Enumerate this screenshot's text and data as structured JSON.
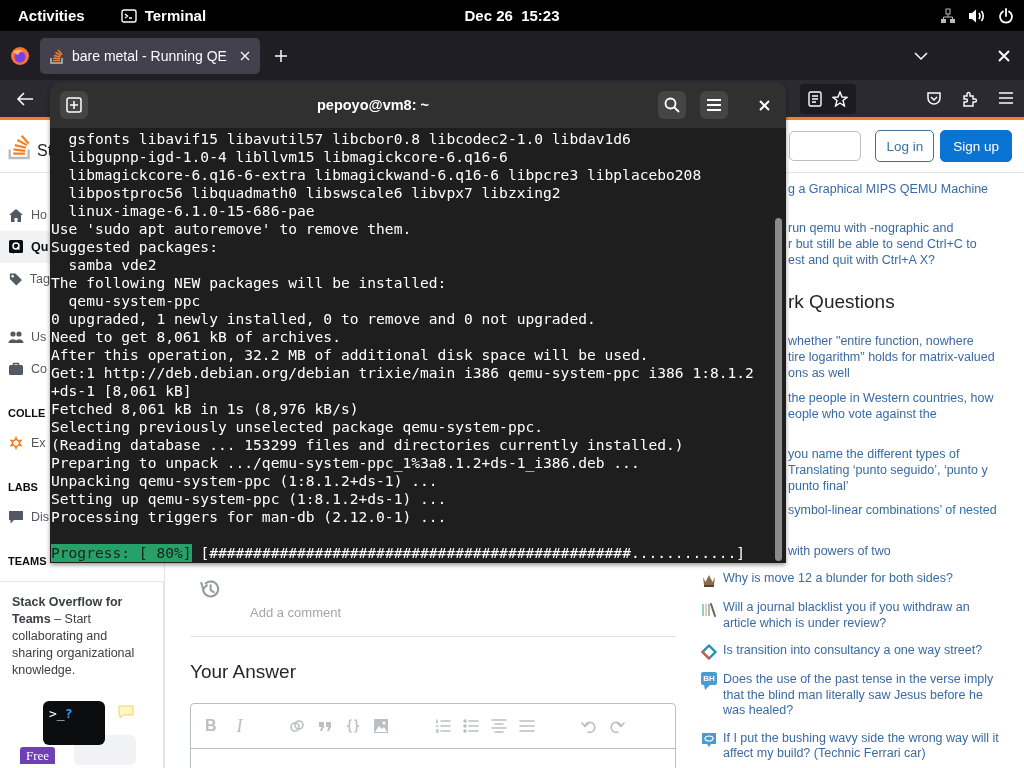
{
  "top_bar": {
    "activities": "Activities",
    "app": "Terminal",
    "clock": "Dec 26  15:23"
  },
  "browser": {
    "tabs": [
      {
        "title": "bare metal - Running QE",
        "selected": true
      }
    ]
  },
  "page": {
    "header": {
      "logo_text": "St",
      "login": "Log in",
      "signup": "Sign up"
    },
    "nav": [
      {
        "kind": "item",
        "label": "Ho",
        "selected": false
      },
      {
        "kind": "item",
        "label": "Qu",
        "selected": true
      },
      {
        "kind": "item",
        "label": "Tag",
        "selected": false
      },
      {
        "kind": "gap"
      },
      {
        "kind": "item",
        "label": "Us",
        "selected": false
      },
      {
        "kind": "item",
        "label": "Co",
        "selected": false
      },
      {
        "kind": "heading",
        "label": "COLLE"
      },
      {
        "kind": "item",
        "label": "Ex",
        "selected": false
      },
      {
        "kind": "heading",
        "label": "LABS"
      },
      {
        "kind": "item",
        "label": "Dis",
        "selected": false
      },
      {
        "kind": "heading",
        "label": "TEAMS"
      }
    ],
    "teams_card": {
      "text": "**Stack Overflow for Teams** – Start collaborating and sharing organizational knowledge.",
      "prompt": ">_",
      "prompt_mark": "?",
      "badge": "Free"
    },
    "main": {
      "add_comment": "Add a comment",
      "answer_heading": "Your Answer",
      "toolbar": [
        {
          "kind": "bold",
          "label": "B"
        },
        {
          "kind": "italic",
          "label": "I"
        },
        {
          "kind": "sep"
        },
        {
          "kind": "link"
        },
        {
          "kind": "quote"
        },
        {
          "kind": "code"
        },
        {
          "kind": "image"
        },
        {
          "kind": "sep"
        },
        {
          "kind": "ol"
        },
        {
          "kind": "ul"
        },
        {
          "kind": "heading"
        },
        {
          "kind": "rule"
        },
        {
          "kind": "sep"
        },
        {
          "kind": "undo"
        },
        {
          "kind": "redo"
        }
      ]
    },
    "related": [
      {
        "text": "g a Graphical MIPS QEMU Machine"
      },
      {
        "text": "run qemu with -nographic and\nr but still be able to send Ctrl+C to\nest and quit with Ctrl+A X?"
      }
    ],
    "hot_heading": "rk Questions",
    "hot": [
      {
        "text": "whether \"entire function, nowhere\ntire logarithm\" holds for matrix-valued\nons as well"
      },
      {
        "text": "the people in Western countries, how\neople who vote against the"
      },
      {
        "text": "you name the different types of\nTranslating ‘punto seguido’, ‘punto y\npunto final’"
      },
      {
        "text": "symbol-linear combinations’ of nested"
      },
      {
        "text": "with powers of two"
      },
      {
        "text": "Why is move 12 a blunder for both sides?"
      },
      {
        "text": "Will a journal blacklist you if you withdraw an article which is under review?"
      },
      {
        "text": "Is transition into consultancy a one way street?"
      },
      {
        "badge": "BH",
        "text": "Does the use of the past tense in the verse imply that the blind man literally saw Jesus before he was healed?"
      },
      {
        "text": "If I put the bushing wavy side the wrong way will it affect my build? (Technic Ferrari car)"
      }
    ]
  },
  "terminal": {
    "title": "pepoyo@vm8: ~",
    "lines": [
      "  gsfonts libavif15 libavutil57 libcbor0.8 libcodec2-1.0 libdav1d6",
      "  libgupnp-igd-1.0-4 libllvm15 libmagickcore-6.q16-6",
      "  libmagickcore-6.q16-6-extra libmagickwand-6.q16-6 libpcre3 libplacebo208",
      "  libpostproc56 libquadmath0 libswscale6 libvpx7 libzxing2",
      "  linux-image-6.1.0-15-686-pae",
      "Use 'sudo apt autoremove' to remove them.",
      "Suggested packages:",
      "  samba vde2",
      "The following NEW packages will be installed:",
      "  qemu-system-ppc",
      "0 upgraded, 1 newly installed, 0 to remove and 0 not upgraded.",
      "Need to get 8,061 kB of archives.",
      "After this operation, 32.2 MB of additional disk space will be used.",
      "Get:1 http://deb.debian.org/debian trixie/main i386 qemu-system-ppc i386 1:8.1.2",
      "+ds-1 [8,061 kB]",
      "Fetched 8,061 kB in 1s (8,976 kB/s)",
      "Selecting previously unselected package qemu-system-ppc.",
      "(Reading database ... 153299 files and directories currently installed.)",
      "Preparing to unpack .../qemu-system-ppc_1%3a8.1.2+ds-1_i386.deb ...",
      "Unpacking qemu-system-ppc (1:8.1.2+ds-1) ...",
      "Setting up qemu-system-ppc (1:8.1.2+ds-1) ...",
      "Processing triggers for man-db (2.12.0-1) ..."
    ],
    "progress": {
      "label": "Progress: [ 80%]",
      "bar": "[################################################............]"
    }
  }
}
